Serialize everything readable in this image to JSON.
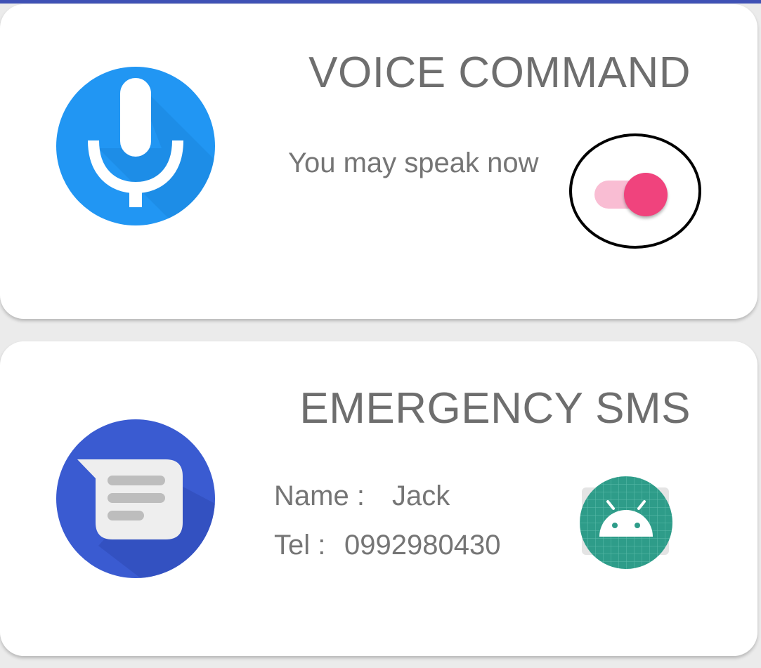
{
  "colors": {
    "accent": "#3f51b5",
    "mic_blue": "#2196f3",
    "messages_blue": "#3a5bd1",
    "switch_thumb": "#f0437d",
    "switch_track": "#f9bdd3",
    "android_green": "#2e9c89"
  },
  "voice_card": {
    "title": "VOICE COMMAND",
    "status_text": "You may speak now",
    "icon": "microphone-icon",
    "switch": {
      "checked": true
    }
  },
  "sms_card": {
    "title": "EMERGENCY SMS",
    "icon": "messages-icon",
    "name_label": "Name :",
    "name_value": "Jack",
    "tel_label": "Tel :",
    "tel_value": "0992980430",
    "contact_icon": "android-icon"
  }
}
